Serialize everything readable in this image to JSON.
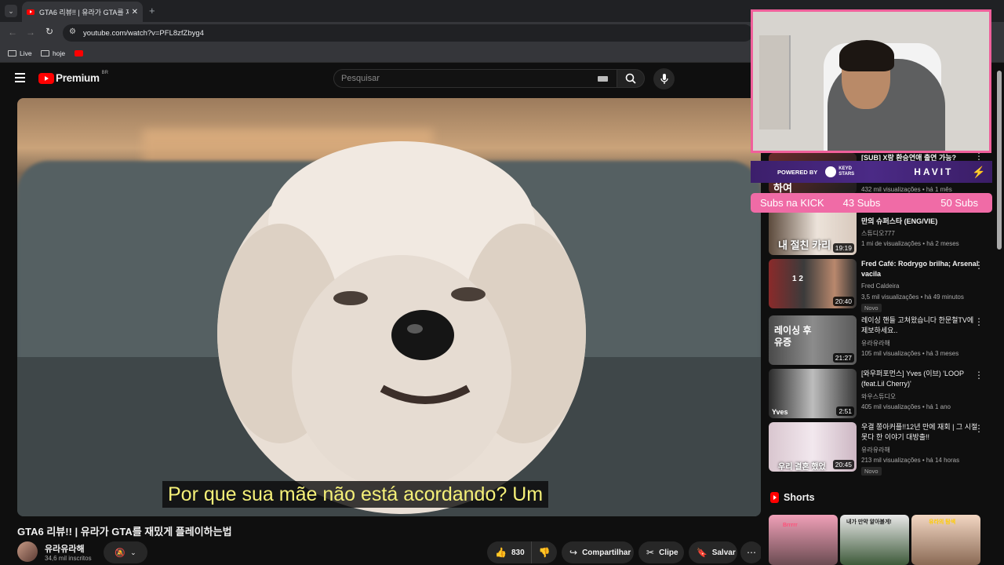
{
  "browser": {
    "tab_title": "GTA6 리뷰!! | 유라가 GTA를 재밌",
    "url": "youtube.com/watch?v=PFL8zfZbyg4",
    "bookmarks": [
      "Live",
      "hoje"
    ]
  },
  "youtube": {
    "logo_text": "Premium",
    "region_badge": "BR",
    "search_placeholder": "Pesquisar"
  },
  "video": {
    "subtitle": "Por que sua mãe não está acordando?  Um",
    "title": "GTA6 리뷰!! | 유라가 GTA를 재밌게 플레이하는법",
    "channel_name": "유라유라해",
    "subscribers": "34,6 mil inscritos",
    "like_count": "830",
    "share_label": "Compartilhar",
    "clip_label": "Clipe",
    "save_label": "Salvar"
  },
  "overlay": {
    "sponsor_powered_by": "POWERED BY",
    "sponsor_brand_1": "KEYD STARS",
    "sponsor_brand_2": "HAVIT",
    "subs_label": "Subs na KICK",
    "subs_current": "43 Subs",
    "subs_goal": "50 Subs",
    "webcam_border_color": "#f0609b"
  },
  "recommendations": [
    {
      "title": "[SUB] X랑 환승연애 출연 가능?",
      "channel": "",
      "meta": "432 mil visualizações • há 1 mês",
      "duration": "",
      "thumb_text": "하여"
    },
    {
      "title": "만의 슈퍼스타 (ENG/VIE)",
      "channel": "스튜디오777",
      "meta": "1 mi de visualizações • há 2 meses",
      "duration": "19:19",
      "thumb_text": "내 절친 카리"
    },
    {
      "title": "Fred Café: Rodrygo brilha; Arsenal vacila",
      "channel": "Fred Caldeira",
      "meta": "3,5 mil visualizações • há 49 minutos",
      "duration": "20:40",
      "badge": "Novo",
      "thumb_text": "1 2"
    },
    {
      "title": "레이싱 핸들 고쳐왔습니다 한문철TV에 제보하세요..",
      "channel": "유라유라해",
      "meta": "105 mil visualizações • há 3 meses",
      "duration": "21:27",
      "thumb_text": "레이싱 후유증"
    },
    {
      "title": "[와우퍼포먼스] Yves (이브) 'LOOP (feat.Lil Cherry)'",
      "channel": "와우스튜디오",
      "meta": "405 mil visualizações • há 1 ano",
      "duration": "2:51",
      "thumb_text": "Yves"
    },
    {
      "title": "우결 쫑아커플!!12년 만에 재회 | 그 시절 못다 한 이야기 대방출!!",
      "channel": "유라유라해",
      "meta": "213 mil visualizações • há 14 horas",
      "duration": "20:45",
      "badge": "Novo",
      "thumb_text": "우리 결혼 했었"
    }
  ],
  "shorts": {
    "heading": "Shorts",
    "thumb_texts": [
      "Brrrrr",
      "내가 만약 알아볼게!",
      "유라의 탐색"
    ]
  }
}
